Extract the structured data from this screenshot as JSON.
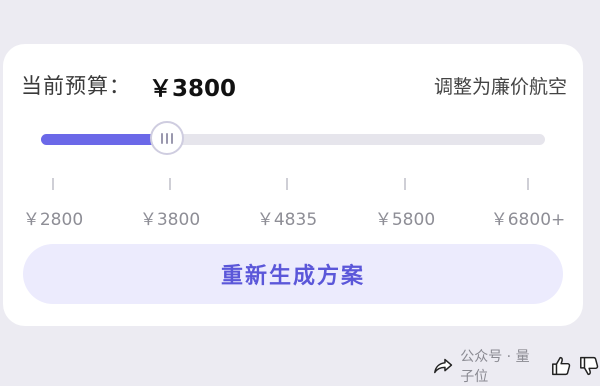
{
  "budget": {
    "label": "当前预算：",
    "value": "￥3800",
    "adjust_link": "调整为廉价航空"
  },
  "slider": {
    "fraction": 0.25,
    "ticks": [
      {
        "label": "￥2800"
      },
      {
        "label": "￥3800"
      },
      {
        "label": "￥4835"
      },
      {
        "label": "￥5800"
      },
      {
        "label": "￥6800+"
      }
    ]
  },
  "regen_button": "重新生成方案",
  "watermark": "公众号 · 量子位",
  "colors": {
    "accent": "#6b68e8",
    "button_bg": "#ecebfd",
    "button_text": "#5b57d9"
  },
  "icons": [
    "share-icon",
    "thumbs-up-icon",
    "thumbs-down-icon"
  ]
}
